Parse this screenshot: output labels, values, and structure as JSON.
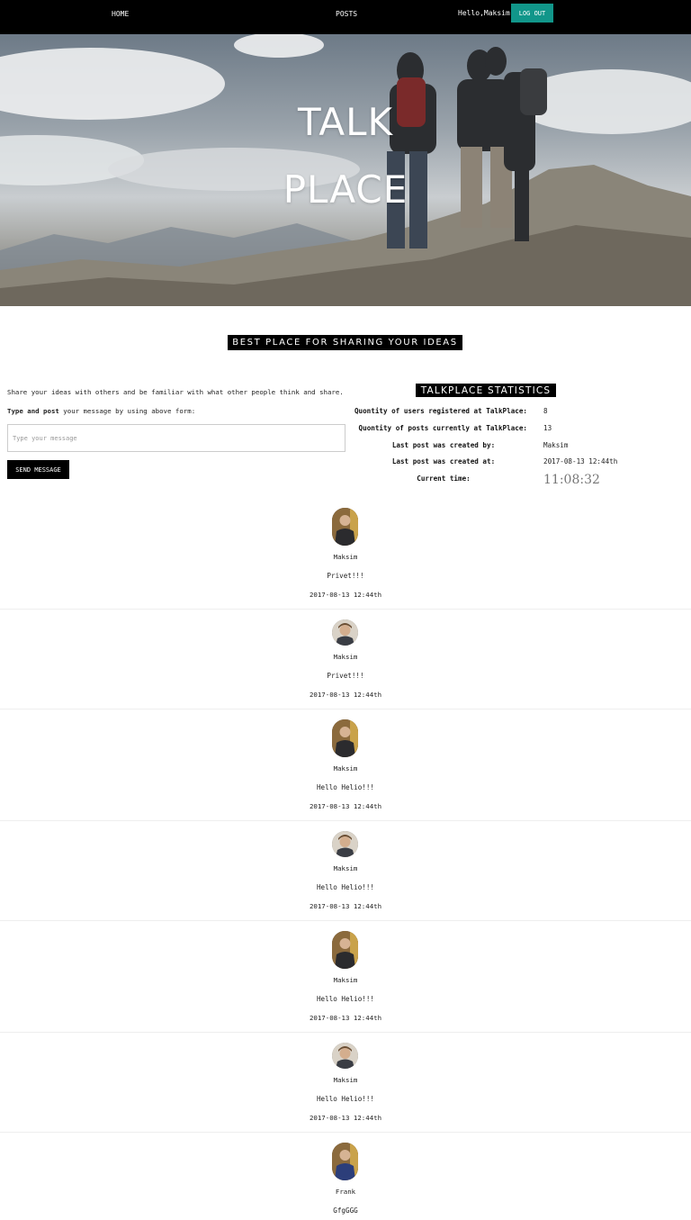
{
  "nav": {
    "home": "HOME",
    "posts": "POSTS",
    "greeting": "Hello,Maksim!",
    "logout": "LOG OUT",
    "accent_color": "#11968a"
  },
  "hero": {
    "title_line1": "TALK",
    "title_line2": "PLACE"
  },
  "tagline": "BEST PLACE FOR SHARING YOUR IDEAS",
  "form": {
    "intro": "Share your ideas with others and be familiar with what other people think and share.",
    "type_bold": "Type and post",
    "type_rest": " your message by using above form:",
    "placeholder": "Type your message",
    "send": "SEND MESSAGE"
  },
  "stats": {
    "title": "TALKPLACE STATISTICS",
    "users_label": "Quontity of users registered at TalkPlace:",
    "users_value": "8",
    "posts_label": "Quontity of posts currently at TalkPlace:",
    "posts_value": "13",
    "last_by_label": "Last post was created by:",
    "last_by_value": "Maksim",
    "last_at_label": "Last post was created at:",
    "last_at_value": "2017-08-13 12:44th",
    "time_label": "Current time:",
    "time_value": "11:08:32"
  },
  "posts": [
    {
      "author": "Maksim",
      "text": "Privet!!!",
      "date": "2017-08-13 12:44th",
      "avatar": "tall-man-icon"
    },
    {
      "author": "Maksim",
      "text": "Privet!!!",
      "date": "2017-08-13 12:44th",
      "avatar": "round-child-icon"
    },
    {
      "author": "Maksim",
      "text": "Hello Helio!!!",
      "date": "2017-08-13 12:44th",
      "avatar": "tall-man-icon"
    },
    {
      "author": "Maksim",
      "text": "Hello Helio!!!",
      "date": "2017-08-13 12:44th",
      "avatar": "round-child-icon"
    },
    {
      "author": "Maksim",
      "text": "Hello Helio!!!",
      "date": "2017-08-13 12:44th",
      "avatar": "tall-man-icon"
    },
    {
      "author": "Maksim",
      "text": "Hello Helio!!!",
      "date": "2017-08-13 12:44th",
      "avatar": "round-child-icon"
    },
    {
      "author": "Frank",
      "text": "GfgGGG",
      "date": "",
      "avatar": "tall-man-blue-icon"
    }
  ]
}
